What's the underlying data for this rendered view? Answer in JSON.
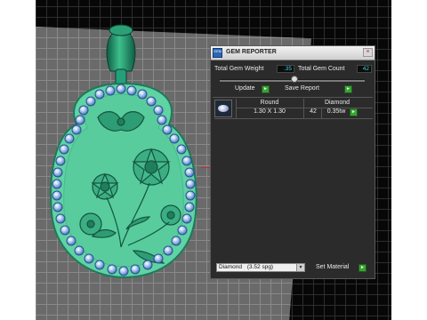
{
  "panel": {
    "title": "GEM REPORTER",
    "app_icon_name": "gem-reporter-app-icon",
    "app_icon_text": "GEM",
    "close_icon_glyph": "×",
    "total_weight_label": "Total Gem Weight",
    "total_weight_value": ".35",
    "total_count_label": "Total Gem Count",
    "total_count_value": "42",
    "update_label": "Update",
    "save_report_label": "Save Report",
    "go_glyph": "►",
    "stone": {
      "shape_header": "Round",
      "size": "1.30 X 1.30",
      "material_header": "Diamond",
      "count": "42",
      "weight": "0.35tw"
    },
    "material_select_value": "Diamond",
    "material_select_detail": "(3.52 spg)",
    "dropdown_glyph": "▼",
    "set_material_label": "Set Material"
  },
  "colors": {
    "jade_green": "#5fd3a4",
    "jade_dark": "#1d6f55",
    "gem_blue": "#8ab4ea",
    "go_green": "#3aa336",
    "value_cyan": "#3fd3e0"
  }
}
